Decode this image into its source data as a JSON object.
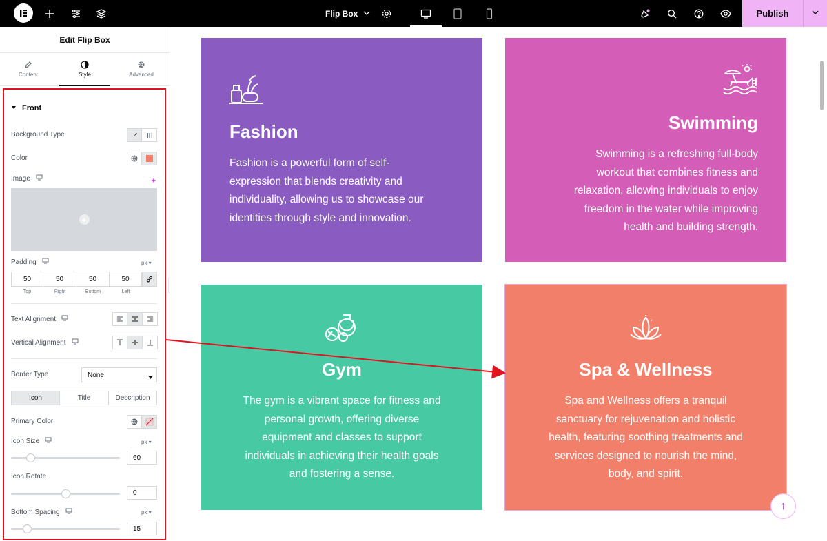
{
  "topbar": {
    "doc_title": "Flip Box",
    "publish_label": "Publish"
  },
  "panel": {
    "title": "Edit Flip Box",
    "tabs": [
      {
        "label": "Content",
        "icon": "pencil-icon"
      },
      {
        "label": "Style",
        "icon": "contrast-icon"
      },
      {
        "label": "Advanced",
        "icon": "gear-icon"
      }
    ],
    "section_title": "Front",
    "background_type_label": "Background Type",
    "color_label": "Color",
    "image_label": "Image",
    "padding_label": "Padding",
    "padding_unit": "px",
    "padding_values": [
      "50",
      "50",
      "50",
      "50"
    ],
    "padding_sides": [
      "Top",
      "Right",
      "Bottom",
      "Left"
    ],
    "text_alignment_label": "Text Alignment",
    "vertical_alignment_label": "Vertical Alignment",
    "border_type_label": "Border Type",
    "border_type_value": "None",
    "sub_tabs": [
      "Icon",
      "Title",
      "Description"
    ],
    "primary_color_label": "Primary Color",
    "icon_size_label": "Icon Size",
    "icon_size_unit": "px",
    "icon_size_value": "60",
    "icon_rotate_label": "Icon Rotate",
    "icon_rotate_value": "0",
    "bottom_spacing_label": "Bottom Spacing",
    "bottom_spacing_unit": "px",
    "bottom_spacing_value": "15"
  },
  "cards": [
    {
      "title": "Fashion",
      "icon": "cosmetics-icon",
      "color": "#8a5cc2",
      "lines": [
        "Fashion is a powerful form of self-",
        "expression that blends creativity and",
        "individuality, allowing us to showcase our",
        "identities through style and innovation."
      ]
    },
    {
      "title": "Swimming",
      "icon": "beach-lounger-icon",
      "color": "#d45db8",
      "lines": [
        "Swimming is a refreshing full-body",
        "workout that combines fitness and",
        "relaxation, allowing individuals to enjoy",
        "freedom in the water while improving",
        "health and building strength."
      ]
    },
    {
      "title": "Gym",
      "icon": "dumbbell-icon",
      "color": "#47c9a4",
      "lines": [
        "The gym is a vibrant space for fitness and",
        "personal growth, offering diverse",
        "equipment and classes to support",
        "individuals in achieving their health goals",
        "and fostering a sense."
      ]
    },
    {
      "title": "Spa & Wellness",
      "icon": "lotus-icon",
      "color": "#f27f6a",
      "lines": [
        "Spa and Wellness offers a tranquil",
        "sanctuary for rejuvenation and holistic",
        "health, featuring soothing treatments and",
        "services designed to nourish the mind,",
        "body, and spirit."
      ]
    }
  ],
  "colors": {
    "accent": "#f0b3f5",
    "annotation": "#e0141e",
    "color_swatch": "#f27f6a"
  }
}
